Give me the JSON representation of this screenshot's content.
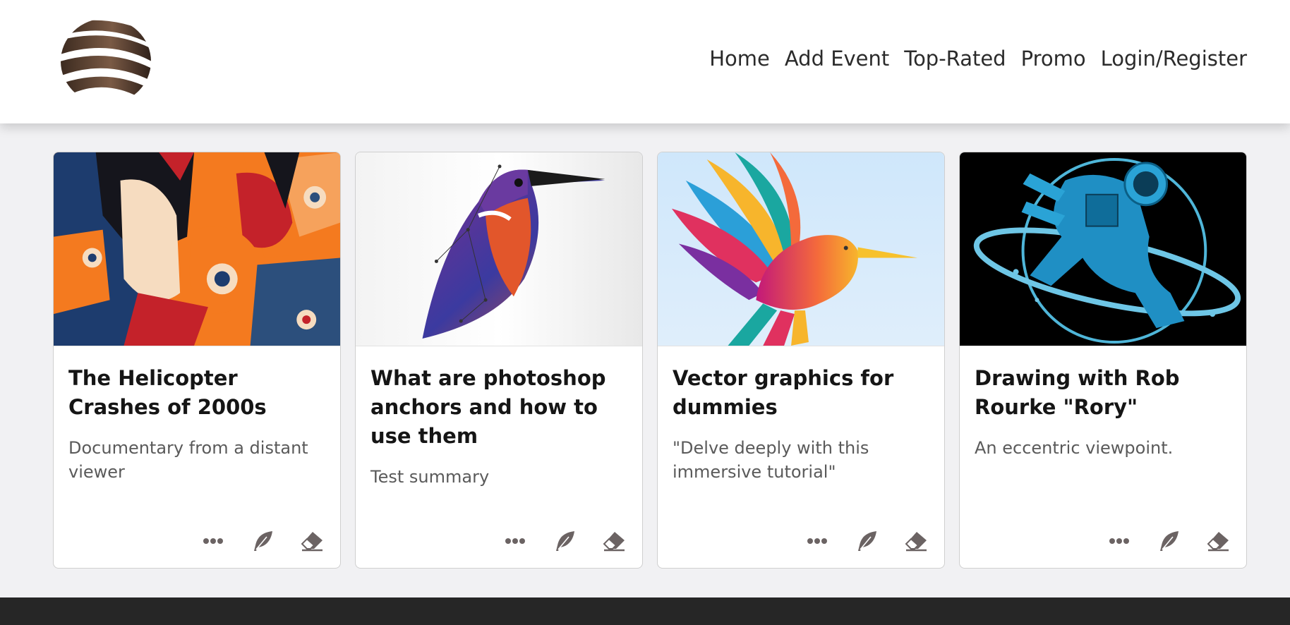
{
  "header": {
    "logo_icon": "striped-sphere-logo",
    "nav": [
      {
        "label": "Home"
      },
      {
        "label": "Add Event"
      },
      {
        "label": "Top-Rated"
      },
      {
        "label": "Promo"
      },
      {
        "label": "Login/Register"
      }
    ]
  },
  "cards": [
    {
      "title": "The Helicopter Crashes of 2000s",
      "summary": "Documentary from a distant viewer",
      "image_icon": "abstract-faces-illustration"
    },
    {
      "title": "What are photoshop anchors and how to use them",
      "summary": "Test summary",
      "image_icon": "kingfisher-vector-illustration"
    },
    {
      "title": "Vector graphics for dummies",
      "summary": "\"Delve deeply with this immersive tutorial\"",
      "image_icon": "hummingbird-illustration"
    },
    {
      "title": "Drawing with Rob Rourke \"Rory\"",
      "summary": "An eccentric viewpoint.",
      "image_icon": "astronaut-illustration"
    }
  ],
  "actions": {
    "more_icon": "ellipsis-icon",
    "edit_icon": "feather-icon",
    "delete_icon": "eraser-icon"
  },
  "colors": {
    "header_bg": "#ffffff",
    "page_bg": "#f1f1f3",
    "footer_bg": "#262626",
    "action_icon": "#6b6363"
  }
}
